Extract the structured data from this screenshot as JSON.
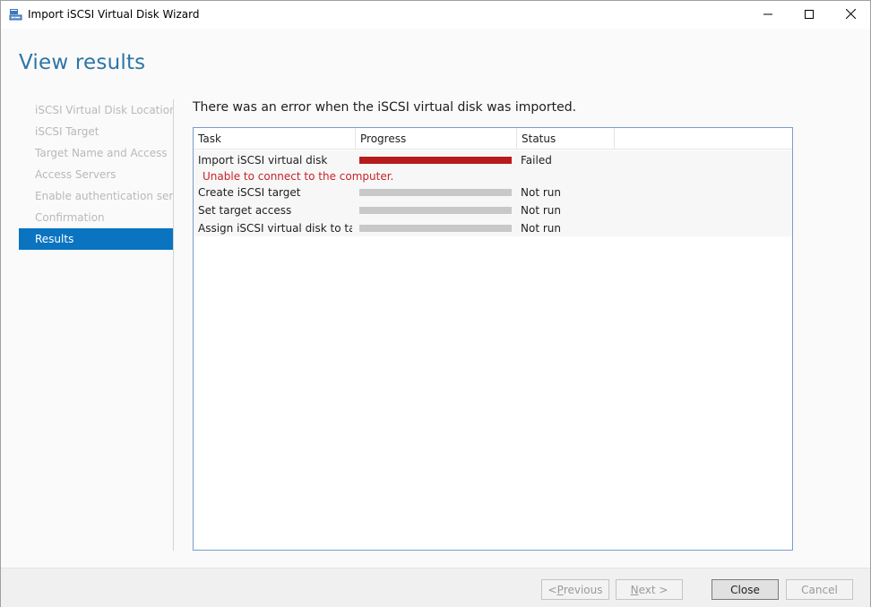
{
  "window": {
    "title": "Import iSCSI Virtual Disk Wizard",
    "icon": "wizard-app-icon",
    "controls": [
      "minimize-icon",
      "maximize-icon",
      "close-icon"
    ]
  },
  "page": {
    "heading": "View results",
    "message": "There was an error when the iSCSI virtual disk was imported."
  },
  "sidebar": {
    "steps": [
      {
        "label": "iSCSI Virtual Disk Location",
        "state": "disabled"
      },
      {
        "label": "iSCSI Target",
        "state": "disabled"
      },
      {
        "label": "Target Name and Access",
        "state": "disabled"
      },
      {
        "label": "Access Servers",
        "state": "disabled"
      },
      {
        "label": "Enable authentication ser...",
        "state": "disabled"
      },
      {
        "label": "Confirmation",
        "state": "disabled"
      },
      {
        "label": "Results",
        "state": "active"
      }
    ]
  },
  "table": {
    "columns": [
      "Task",
      "Progress",
      "Status"
    ],
    "rows": [
      {
        "task": "Import iSCSI virtual disk",
        "progress": 1.0,
        "status": "Failed",
        "error": "Unable to connect to the computer."
      },
      {
        "task": "Create iSCSI target",
        "progress": 0,
        "status": "Not run"
      },
      {
        "task": "Set target access",
        "progress": 0,
        "status": "Not run"
      },
      {
        "task": "Assign iSCSI virtual disk to target",
        "progress": 0,
        "status": "Not run"
      }
    ]
  },
  "footer": {
    "previous": {
      "underline": "P",
      "before": "< ",
      "after": "revious"
    },
    "next": {
      "underline": "N",
      "before": "",
      "after": "ext >"
    },
    "close": "Close",
    "cancel": "Cancel"
  },
  "colors": {
    "accent": "#0a74c1",
    "heading": "#2e75a6",
    "error": "#c8232a",
    "progress_failed": "#b71c1c",
    "progress_empty": "#c8c8c8"
  }
}
